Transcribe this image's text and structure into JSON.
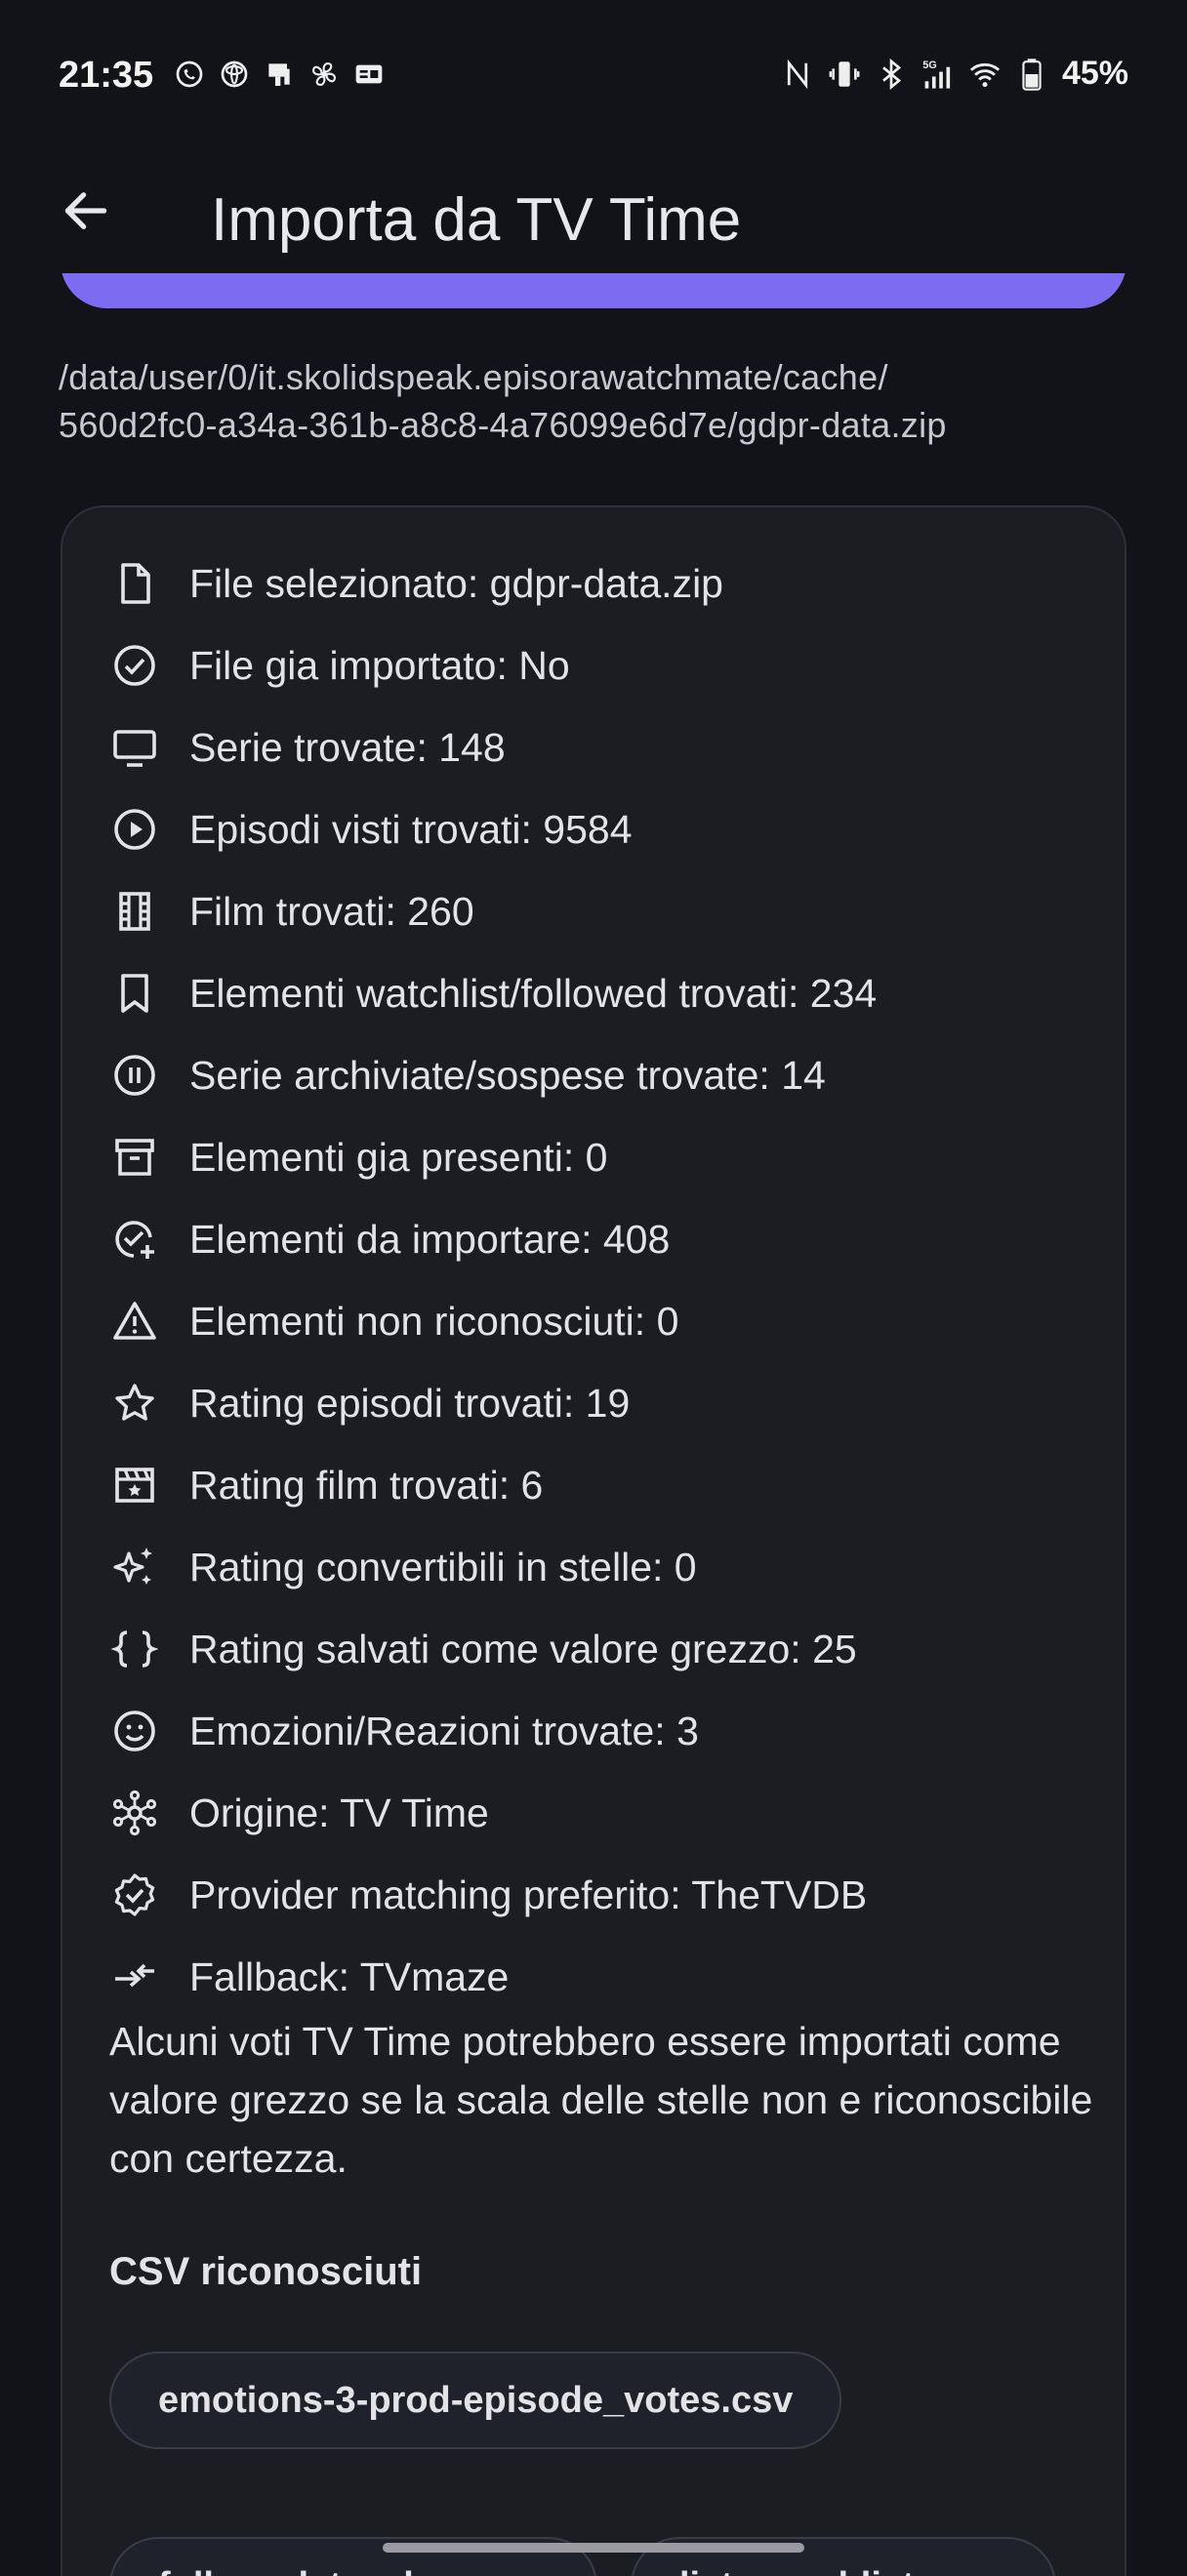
{
  "status_bar": {
    "time": "21:35",
    "battery": "45%",
    "left_icons": [
      "whatsapp-icon",
      "toyota-icon",
      "notification-app-icon",
      "fan-icon",
      "id-card-icon"
    ],
    "right_icons": [
      "nfc-icon",
      "vibrate-icon",
      "bluetooth-icon",
      "signal-5g-icon",
      "wifi-icon",
      "battery-icon"
    ]
  },
  "app_bar": {
    "title": "Importa da TV Time"
  },
  "file_path": "/data/user/0/it.skolidspeak.episorawatchmate/cache/\n560d2fc0-a34a-361b-a8c8-4a76099e6d7e/gdpr-data.zip",
  "info": [
    {
      "icon": "file-icon",
      "text": "File selezionato: gdpr-data.zip"
    },
    {
      "icon": "check-circle-icon",
      "text": "File gia importato: No"
    },
    {
      "icon": "tv-icon",
      "text": "Serie trovate: 148"
    },
    {
      "icon": "play-circle-icon",
      "text": "Episodi visti trovati: 9584"
    },
    {
      "icon": "film-icon",
      "text": "Film trovati: 260"
    },
    {
      "icon": "bookmark-icon",
      "text": "Elementi watchlist/followed trovati: 234"
    },
    {
      "icon": "pause-circle-icon",
      "text": "Serie archiviate/sospese trovate: 14"
    },
    {
      "icon": "archive-icon",
      "text": "Elementi gia presenti: 0"
    },
    {
      "icon": "check-add-icon",
      "text": "Elementi da importare: 408"
    },
    {
      "icon": "warning-icon",
      "text": "Elementi non riconosciuti: 0"
    },
    {
      "icon": "star-icon",
      "text": "Rating episodi trovati: 19"
    },
    {
      "icon": "movie-clapper-icon",
      "text": "Rating film trovati: 6"
    },
    {
      "icon": "sparkle-icon",
      "text": "Rating convertibili in stelle: 0"
    },
    {
      "icon": "braces-icon",
      "text": "Rating salvati come valore grezzo: 25"
    },
    {
      "icon": "smile-icon",
      "text": "Emozioni/Reazioni trovate: 3"
    },
    {
      "icon": "hub-icon",
      "text": "Origine: TV Time"
    },
    {
      "icon": "verified-icon",
      "text": "Provider matching preferito: TheTVDB"
    },
    {
      "icon": "fallback-arrow-icon",
      "text": "Fallback: TVmaze"
    }
  ],
  "note": "Alcuni voti TV Time potrebbero essere importati come valore grezzo se la scala delle stelle non e riconoscibile con certezza.",
  "csv_section": {
    "heading": "CSV riconosciuti",
    "chips": [
      "emotions-3-prod-episode_votes.csv",
      "followed_tv_show.csv",
      "liste-prod-liste.csv"
    ]
  },
  "colors": {
    "background": "#111318",
    "card": "#1b1d23",
    "accent": "#7c6cf2",
    "text": "#e3e2e6"
  }
}
